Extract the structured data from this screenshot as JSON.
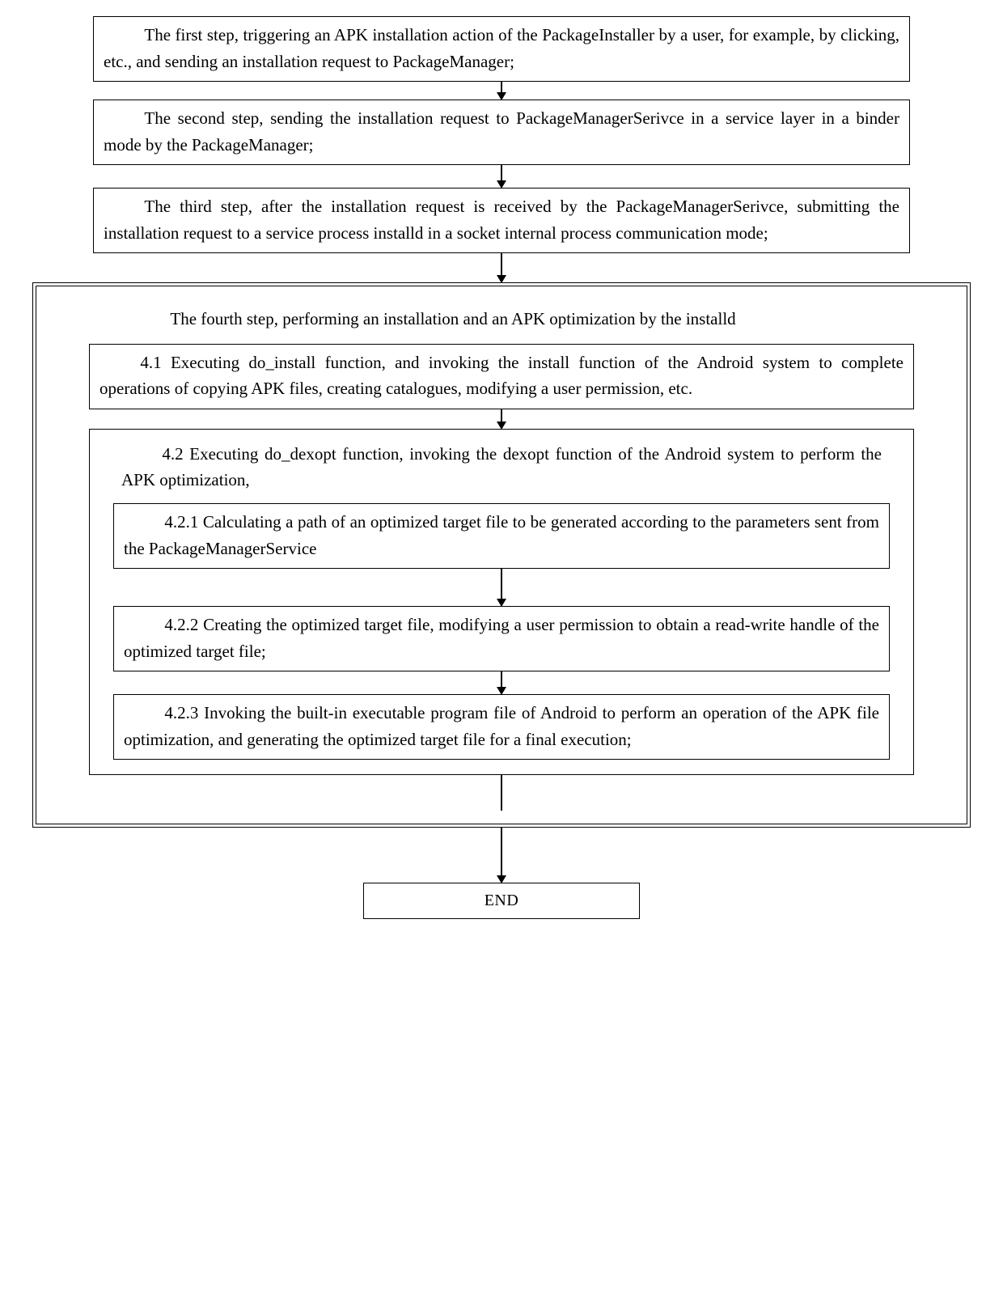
{
  "step1": "The first step, triggering an APK installation action of the PackageInstaller by a user, for example, by clicking, etc., and sending an installation request to PackageManager;",
  "step2": "The second step, sending the installation request to PackageManagerSerivce in a service layer in a binder mode by the PackageManager;",
  "step3": "The third step, after the installation request is received by the PackageManagerSerivce, submitting the installation request to a service process installd in a socket internal process communication mode;",
  "step4_title": "The fourth step, performing an installation and an APK optimization by the installd",
  "step4_1": "4.1 Executing do_install function, and invoking the install function of the Android system to complete operations of copying APK files, creating catalogues, modifying a user permission, etc.",
  "step4_2_title": "4.2 Executing do_dexopt function, invoking the dexopt function of the Android system to perform the APK optimization,",
  "step4_2_1": "4.2.1 Calculating a path of an optimized target file to be generated according to the parameters sent from the PackageManagerService",
  "step4_2_2": "4.2.2 Creating the optimized target file, modifying a user permission to obtain a read-write handle of the optimized target file;",
  "step4_2_3": "4.2.3 Invoking the built-in executable program file of Android to perform an operation of the APK file optimization, and generating the optimized target file for a final execution;",
  "end": "END"
}
